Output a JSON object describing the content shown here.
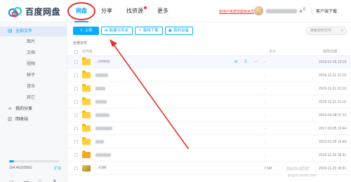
{
  "app": {
    "name": "百度网盘"
  },
  "nav": {
    "items": [
      {
        "label": "网盘",
        "active": true
      },
      {
        "label": "分享",
        "active": false
      },
      {
        "label": "找资源",
        "active": false,
        "dot": true
      },
      {
        "label": "更多",
        "active": false
      }
    ]
  },
  "header": {
    "promo": "新用户免费领超级会员",
    "notif_count": "0",
    "client_label": "客户端下载"
  },
  "sidebar": {
    "items": [
      {
        "label": "全部文件",
        "icon": "folder-icon",
        "active": true
      },
      {
        "label": "图片"
      },
      {
        "label": "文档"
      },
      {
        "label": "视频"
      },
      {
        "label": "种子"
      },
      {
        "label": "音乐"
      },
      {
        "label": "其它"
      },
      {
        "label": "我的分享",
        "icon": "share-icon"
      },
      {
        "label": "回收站",
        "icon": "trash-icon"
      }
    ],
    "quota_text": "204.4G/2056G",
    "quota_fraction": 0.1,
    "expand_label": "扩容"
  },
  "toolbar": {
    "upload": "上传",
    "new_folder": "新建文件夹",
    "offline_download": "离线下载",
    "my_devices": "我的设备",
    "search_placeholder": "搜索您的文件"
  },
  "breadcrumb": "全部文件",
  "list": {
    "headers": {
      "name": "文件名",
      "size": "大小",
      "date": "修改日期"
    },
    "rows": [
      {
        "name": "...ovoxxa",
        "size": "-",
        "date": "2019-01-26 19:36",
        "type": "folder",
        "hover": true
      },
      {
        "name": "",
        "size": "-",
        "date": "2019-11-21 21:16",
        "type": "folder"
      },
      {
        "name": "",
        "size": "-",
        "date": "2019-11-21 21:16",
        "type": "folder"
      },
      {
        "name": "",
        "size": "-",
        "date": "2019-11-21 21:16",
        "type": "folder"
      },
      {
        "name": "",
        "size": "-",
        "date": "2019-03-08 07:12",
        "type": "folder"
      },
      {
        "name": "",
        "size": "-",
        "date": "2017-02-05 12:44",
        "type": "folder"
      },
      {
        "name": "",
        "size": "-",
        "date": "2019-01-26 19:40",
        "type": "folder"
      },
      {
        "name": "",
        "size": "-",
        "date": "2019-11-29 18:31",
        "type": "folder-special"
      },
      {
        "name": "...4.5M",
        "size": "7.5M",
        "date": "2019-11-29 18:31",
        "type": "image"
      }
    ]
  },
  "watermark": {
    "line1": "Baidu经验",
    "line2": "jingyan.baidu.com"
  },
  "colors": {
    "accent": "#09aaff",
    "annotation": "#e3312d",
    "folder": "#ffcf3d"
  }
}
